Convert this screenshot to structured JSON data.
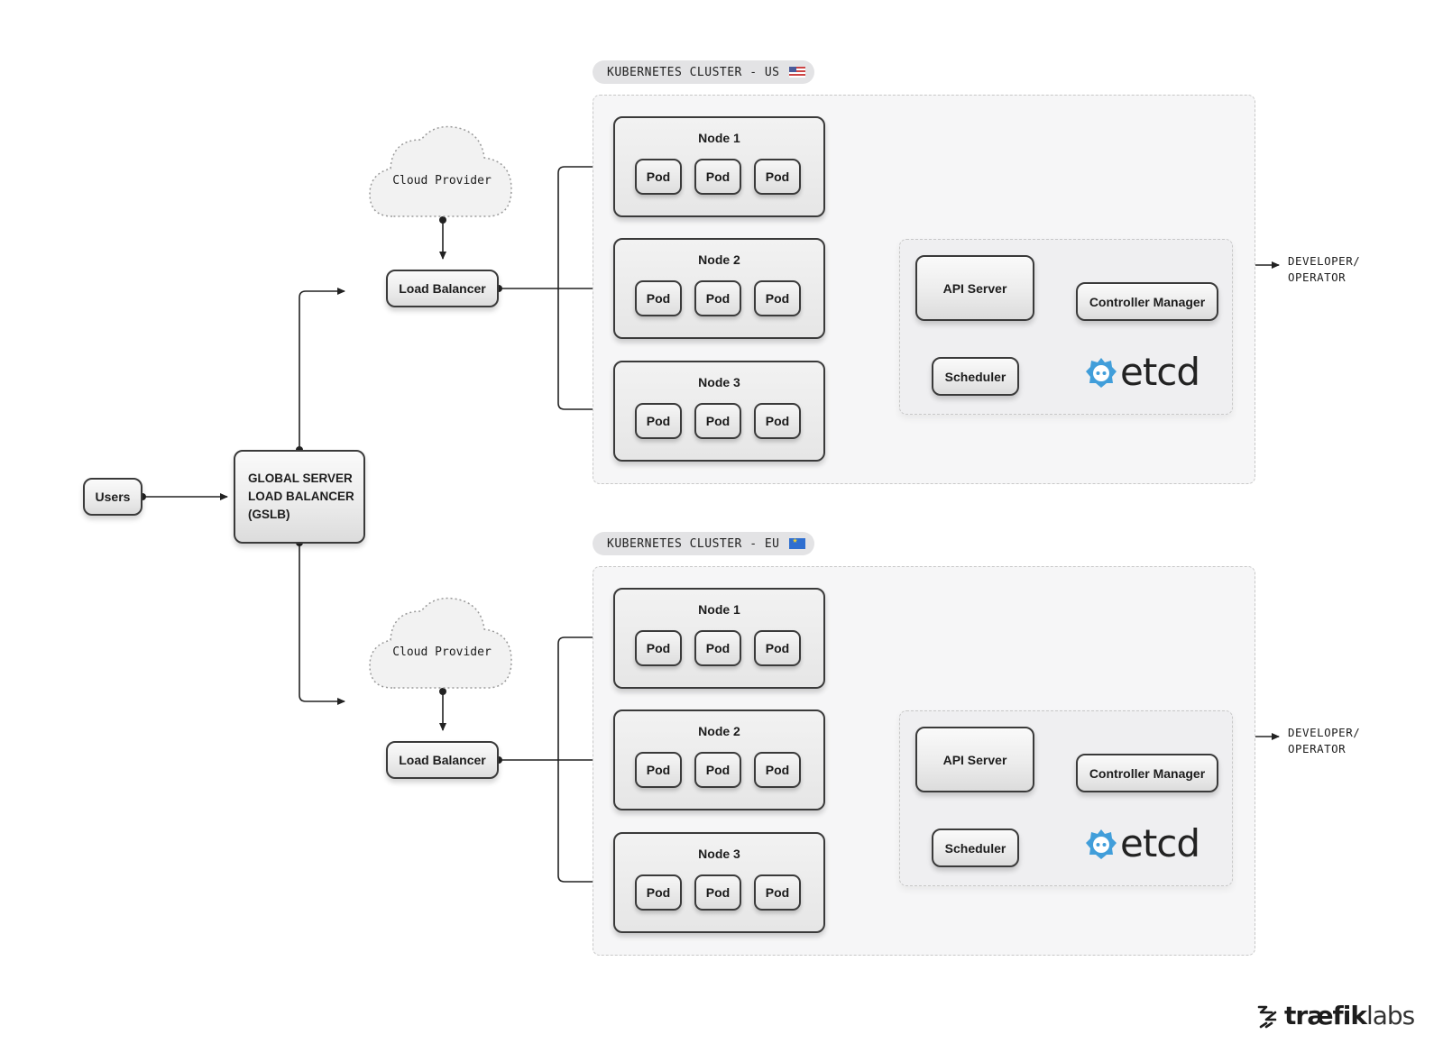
{
  "users": {
    "label": "Users"
  },
  "gslb": {
    "lines": [
      "GLOBAL SERVER",
      "LOAD BALANCER",
      "(GSLB)"
    ]
  },
  "clusters": [
    {
      "label": "KUBERNETES CLUSTER - US",
      "flag_icon": "us-flag-icon",
      "cloud_provider": "Cloud Provider",
      "load_balancer": "Load Balancer",
      "nodes": [
        {
          "title": "Node 1",
          "pods": [
            "Pod",
            "Pod",
            "Pod"
          ]
        },
        {
          "title": "Node 2",
          "pods": [
            "Pod",
            "Pod",
            "Pod"
          ]
        },
        {
          "title": "Node 3",
          "pods": [
            "Pod",
            "Pod",
            "Pod"
          ]
        }
      ],
      "control_plane": {
        "api_server": "API Server",
        "controller_manager": "Controller Manager",
        "scheduler": "Scheduler",
        "etcd": "etcd"
      },
      "developer_label": [
        "DEVELOPER/",
        "OPERATOR"
      ]
    },
    {
      "label": "KUBERNETES CLUSTER - EU",
      "flag_icon": "eu-flag-icon",
      "cloud_provider": "Cloud Provider",
      "load_balancer": "Load Balancer",
      "nodes": [
        {
          "title": "Node 1",
          "pods": [
            "Pod",
            "Pod",
            "Pod"
          ]
        },
        {
          "title": "Node 2",
          "pods": [
            "Pod",
            "Pod",
            "Pod"
          ]
        },
        {
          "title": "Node 3",
          "pods": [
            "Pod",
            "Pod",
            "Pod"
          ]
        }
      ],
      "control_plane": {
        "api_server": "API Server",
        "controller_manager": "Controller Manager",
        "scheduler": "Scheduler",
        "etcd": "etcd"
      },
      "developer_label": [
        "DEVELOPER/",
        "OPERATOR"
      ]
    }
  ],
  "brand": {
    "bold": "træfik",
    "light": "labs"
  },
  "colors": {
    "etcd_blue": "#419eda",
    "line": "#222222"
  }
}
